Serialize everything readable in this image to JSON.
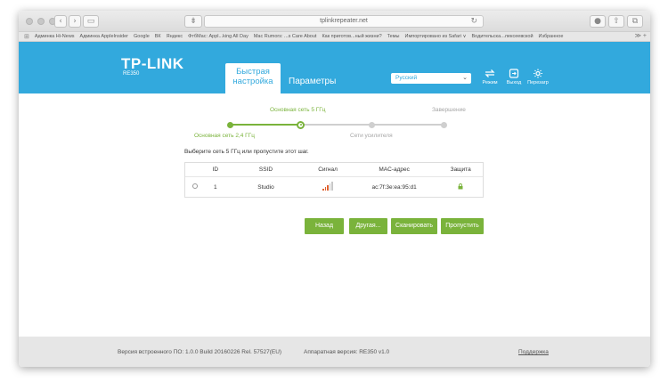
{
  "browser": {
    "address": "tplinkrepeater.net",
    "bookmarks": [
      "Админка Hi-News",
      "Админка AppleInsider",
      "Google",
      "ВК",
      "Яндекс",
      "ФтбМас: Аррl...king All Day",
      "Mac Rumors: ...s Care About",
      "Как приготов...ный жизни?",
      "Темы",
      "Импортировано из Safari ∨",
      "Водительска...лексеевской",
      "Избранное"
    ],
    "more_label": "≫ +"
  },
  "header": {
    "logo": "TP-LINK",
    "model": "RE350",
    "tab_quick_line1": "Быстрая",
    "tab_quick_line2": "настройка",
    "tab_params": "Параметры",
    "language": "Русский",
    "mode_label": "Режим",
    "logout_label": "Выход",
    "reboot_label": "Перезагр"
  },
  "wizard": {
    "step1": "Основная сеть 2,4 ГГц",
    "step2": "Основная сеть 5 ГГц",
    "step3": "Сети усилителя",
    "step4": "Завершение",
    "instruction": "Выберите сеть 5 ГГц или пропустите этот шаг."
  },
  "table": {
    "columns": [
      "ID",
      "SSID",
      "Сигнал",
      "MAC-адрес",
      "Защита"
    ],
    "rows": [
      {
        "id": "1",
        "ssid": "Studio",
        "mac": "ac:7f:3e:ea:95:d1",
        "signal_level": 3,
        "signal_max": 5,
        "secured": true
      }
    ]
  },
  "buttons": {
    "back": "Назад",
    "other": "Другая...",
    "scan": "Сканировать",
    "skip": "Пропустить"
  },
  "footer": {
    "firmware": "Версия встроенного ПО: 1.0.0 Build 20160226 Rel. 57527(EU)",
    "hardware": "Аппаратная версия: RE350 v1.0",
    "support": "Поддержка"
  },
  "colors": {
    "brand_blue": "#32a9dd",
    "accent_green": "#7ab33b",
    "signal_active": "#e0612e",
    "signal_inactive": "#c8c8c8"
  }
}
